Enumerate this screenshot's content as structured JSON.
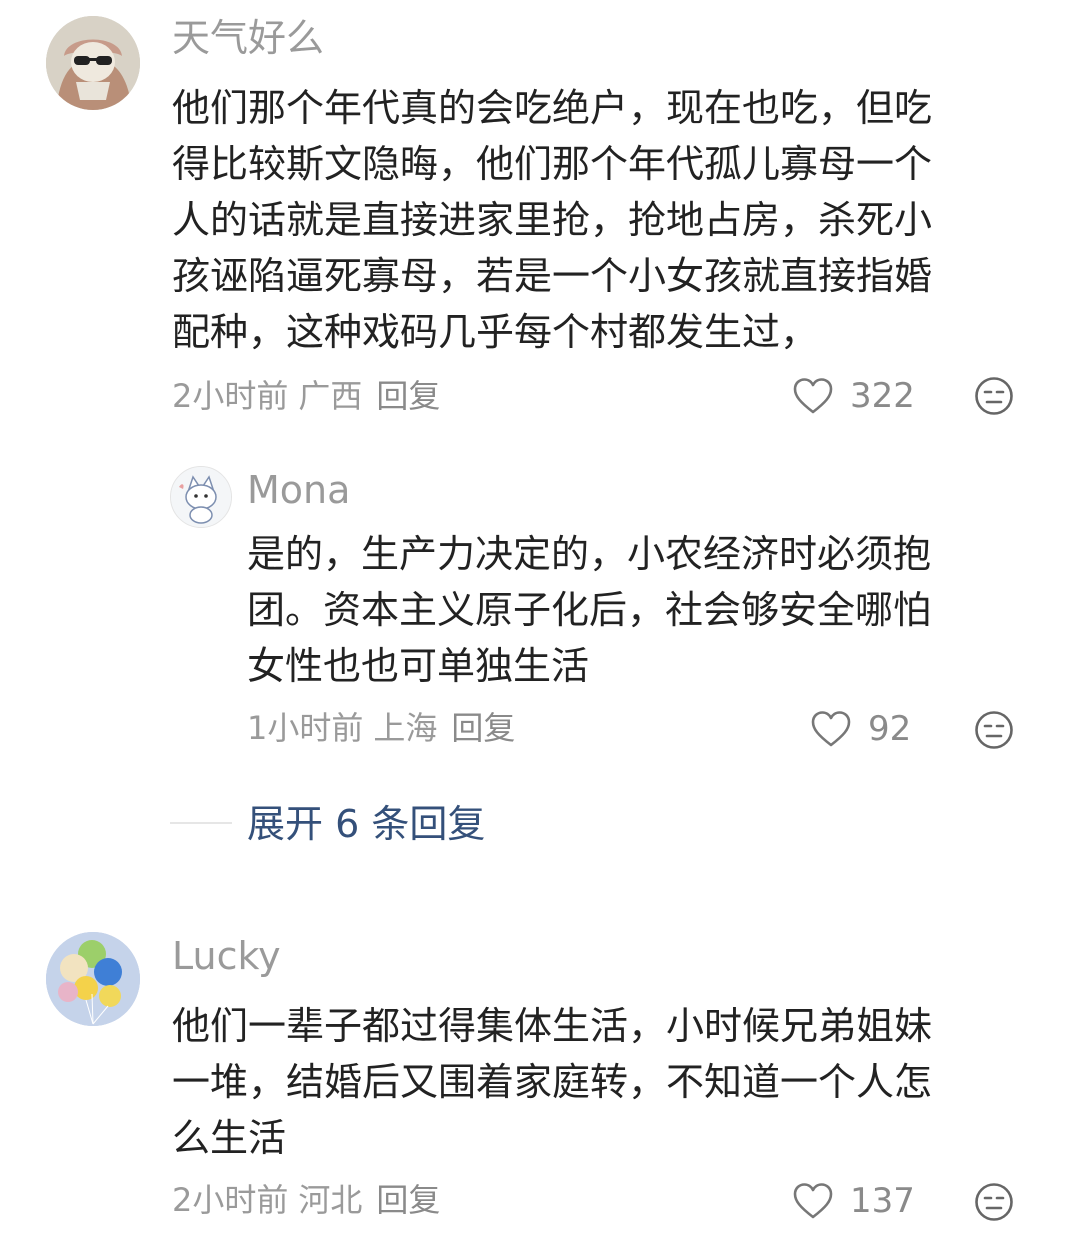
{
  "comments": [
    {
      "username": "天气好么",
      "lines": [
        "他们那个年代真的会吃绝户，现在也吃，但吃",
        "得比较斯文隐晦，他们那个年代孤儿寡母一个",
        "人的话就是直接进家里抢，抢地占房，杀死小",
        "孩诬陷逼死寡母，若是一个小女孩就直接指婚",
        "配种，这种戏码几乎每个村都发生过，"
      ],
      "time": "2小时前",
      "region": "广西",
      "reply_label": "回复",
      "likes": "322",
      "avatar_icon": "cat-sunglasses-avatar"
    },
    {
      "username": "Mona",
      "lines": [
        "是的，生产力决定的，小农经济时必须抱",
        "团。资本主义原子化后，社会够安全哪怕",
        "女性也也可单独生活"
      ],
      "time": "1小时前",
      "region": "上海",
      "reply_label": "回复",
      "likes": "92",
      "avatar_icon": "cartoon-cat-avatar"
    },
    {
      "username": "Lucky",
      "lines": [
        "他们一辈子都过得集体生活，小时候兄弟姐妹",
        "一堆，结婚后又围着家庭转，不知道一个人怎",
        "么生活"
      ],
      "time": "2小时前",
      "region": "河北",
      "reply_label": "回复",
      "likes": "137",
      "avatar_icon": "balloons-avatar"
    }
  ],
  "expand_replies": "展开 6 条回复",
  "colors": {
    "text": "#222222",
    "muted": "#9a9a9a",
    "link": "#34507a"
  }
}
